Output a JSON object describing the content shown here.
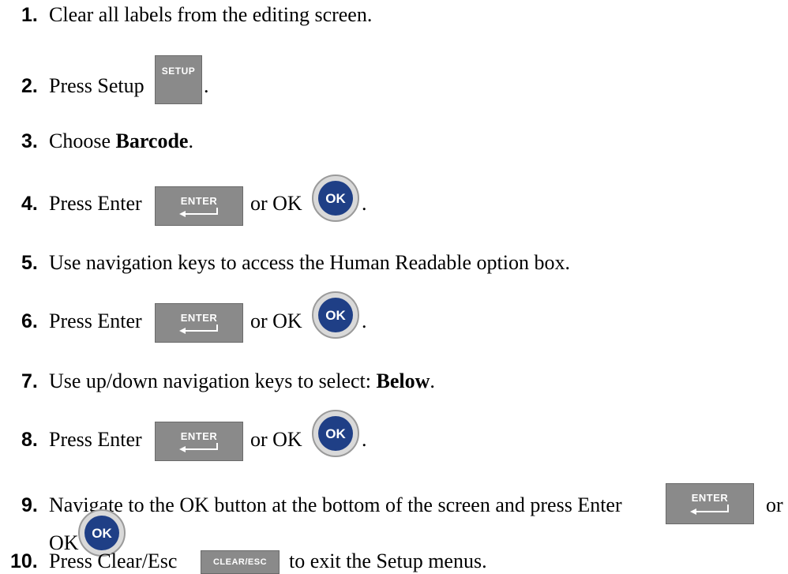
{
  "steps": [
    {
      "number": "1.",
      "text": "Clear all labels from the editing screen."
    },
    {
      "number": "2.",
      "text": "Press Setup",
      "after": "."
    },
    {
      "number": "3.",
      "text": "Choose ",
      "bold": "Barcode",
      "after": "."
    },
    {
      "number": "4.",
      "text": "Press Enter",
      "or": "or OK",
      "after": "."
    },
    {
      "number": "5.",
      "text": "Use navigation keys to access the Human Readable option box."
    },
    {
      "number": "6.",
      "text": "Press Enter",
      "or": "or OK",
      "after": "."
    },
    {
      "number": "7.",
      "text": "Use up/down navigation keys to select: ",
      "bold": "Below",
      "after": "."
    },
    {
      "number": "8.",
      "text": "Press Enter",
      "or": "or OK",
      "after": "."
    },
    {
      "number": "9.",
      "text": "Navigate to the OK button at the bottom of the screen and press Enter",
      "or": "or",
      "line2": "OK"
    },
    {
      "number": "10.",
      "text": "Press Clear/Esc",
      "after": "to exit the Setup menus."
    }
  ],
  "keys": {
    "setup": "SETUP",
    "enter": "ENTER",
    "ok": "OK",
    "clear_esc": "CLEAR/ESC"
  },
  "colors": {
    "key_gray": "#8a8a8a",
    "ok_blue": "#1f3f86"
  }
}
